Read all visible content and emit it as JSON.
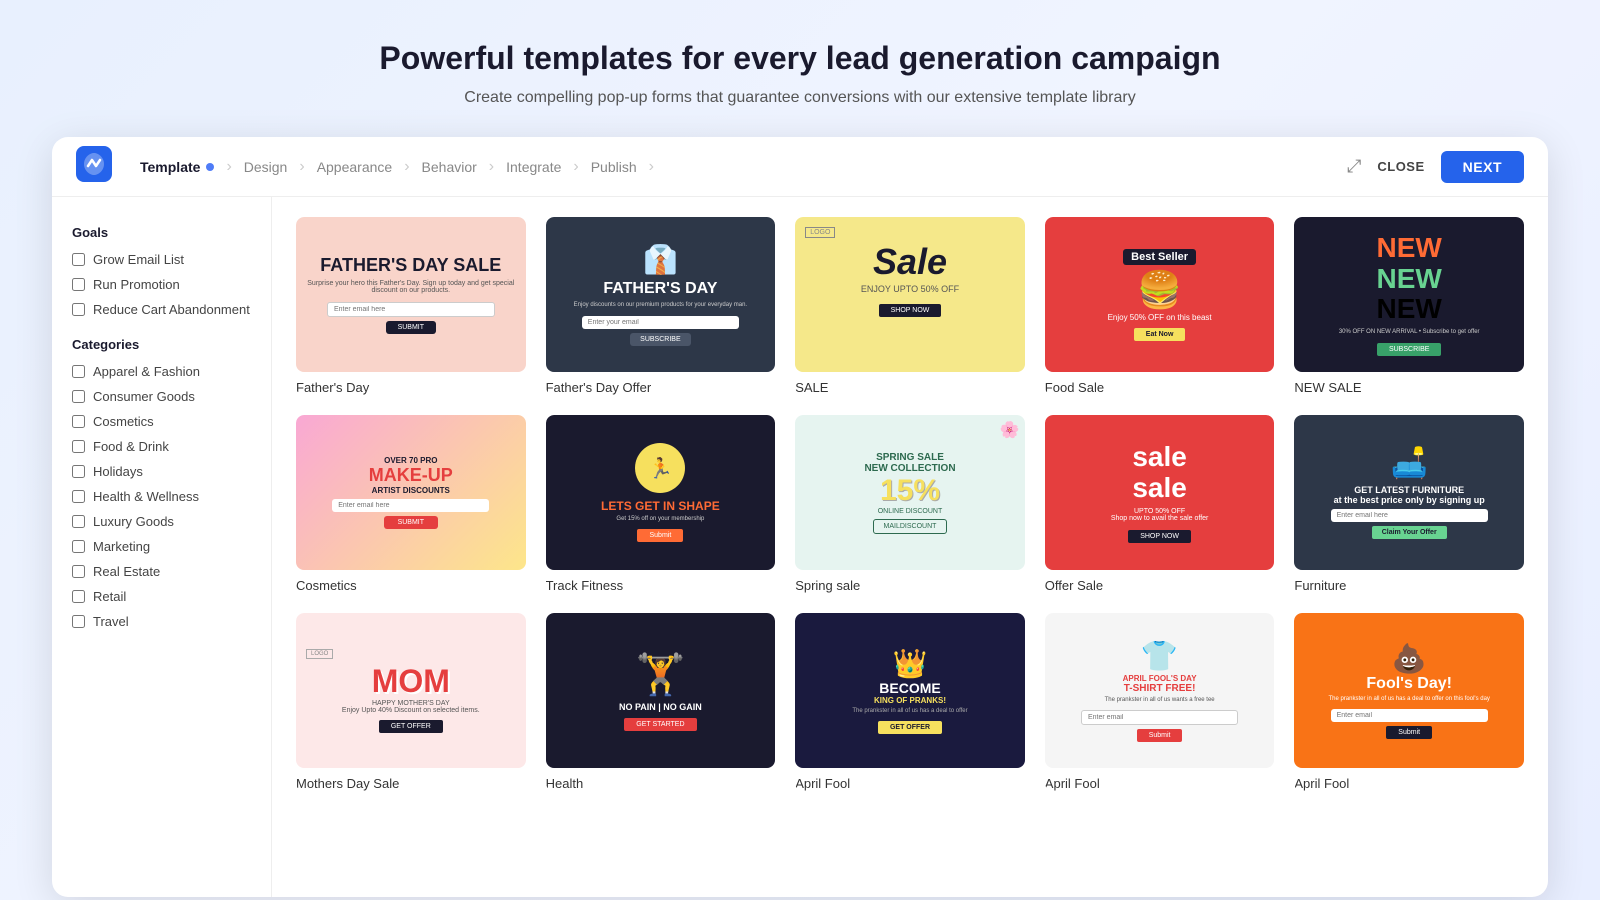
{
  "page": {
    "headline": "Powerful templates for every lead generation campaign",
    "subheadline": "Create compelling pop-up forms that guarantee conversions with our extensive template library"
  },
  "nav": {
    "logo_alt": "Brand Logo",
    "steps": [
      {
        "label": "Template",
        "active": true,
        "has_dot": true
      },
      {
        "label": "Design",
        "active": false,
        "has_dot": false
      },
      {
        "label": "Appearance",
        "active": false,
        "has_dot": false
      },
      {
        "label": "Behavior",
        "active": false,
        "has_dot": false
      },
      {
        "label": "Integrate",
        "active": false,
        "has_dot": false
      },
      {
        "label": "Publish",
        "active": false,
        "has_dot": false
      }
    ],
    "close_label": "CLOSE",
    "next_label": "NEXT"
  },
  "sidebar": {
    "goals_title": "Goals",
    "goals": [
      {
        "label": "Grow Email List",
        "checked": false
      },
      {
        "label": "Run Promotion",
        "checked": false
      },
      {
        "label": "Reduce Cart Abandonment",
        "checked": false
      }
    ],
    "categories_title": "Categories",
    "categories": [
      {
        "label": "Apparel & Fashion",
        "checked": false
      },
      {
        "label": "Consumer Goods",
        "checked": false
      },
      {
        "label": "Cosmetics",
        "checked": false
      },
      {
        "label": "Food & Drink",
        "checked": false
      },
      {
        "label": "Holidays",
        "checked": false
      },
      {
        "label": "Health & Wellness",
        "checked": false
      },
      {
        "label": "Luxury Goods",
        "checked": false
      },
      {
        "label": "Marketing",
        "checked": false
      },
      {
        "label": "Real Estate",
        "checked": false
      },
      {
        "label": "Retail",
        "checked": false
      },
      {
        "label": "Travel",
        "checked": false
      }
    ]
  },
  "templates": [
    {
      "id": "fathers-day",
      "name": "Father's Day",
      "type": "fathers-day"
    },
    {
      "id": "fathers-offer",
      "name": "Father's Day Offer",
      "type": "fathers-offer"
    },
    {
      "id": "sale",
      "name": "SALE",
      "type": "sale"
    },
    {
      "id": "food-sale",
      "name": "Food Sale",
      "type": "food-sale"
    },
    {
      "id": "new-sale",
      "name": "NEW SALE",
      "type": "new-sale"
    },
    {
      "id": "cosmetics",
      "name": "Cosmetics",
      "type": "cosmetics"
    },
    {
      "id": "fitness",
      "name": "Track Fitness",
      "type": "fitness"
    },
    {
      "id": "spring",
      "name": "Spring sale",
      "type": "spring"
    },
    {
      "id": "offer-sale",
      "name": "Offer Sale",
      "type": "offer-sale"
    },
    {
      "id": "furniture",
      "name": "Furniture",
      "type": "furniture"
    },
    {
      "id": "mothers",
      "name": "Mothers Day Sale",
      "type": "mothers"
    },
    {
      "id": "health",
      "name": "Health",
      "type": "health"
    },
    {
      "id": "april-pranks",
      "name": "April Fool",
      "type": "april-pranks"
    },
    {
      "id": "april-shirt",
      "name": "April Fool",
      "type": "april-shirt"
    },
    {
      "id": "fools-day",
      "name": "April Fool",
      "type": "fools-day"
    }
  ]
}
